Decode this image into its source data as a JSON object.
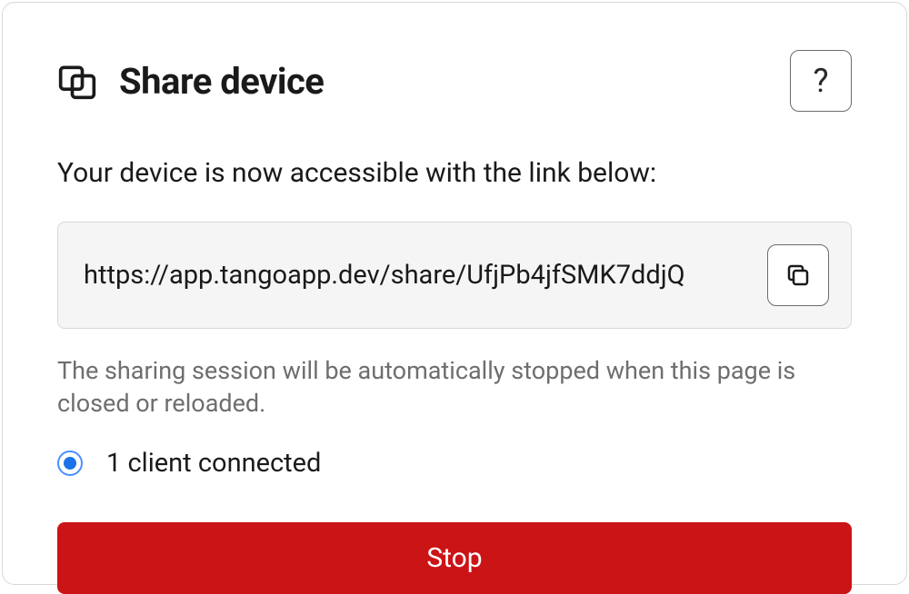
{
  "header": {
    "title": "Share device",
    "help_label": "?"
  },
  "body": {
    "description": "Your device is now accessible with the link below:",
    "share_url": "https://app.tangoapp.dev/share/UfjPb4jfSMK7ddjQ",
    "note": "The sharing session will be automatically stopped when this page is closed or reloaded.",
    "status_text": "1 client connected",
    "stop_label": "Stop"
  }
}
